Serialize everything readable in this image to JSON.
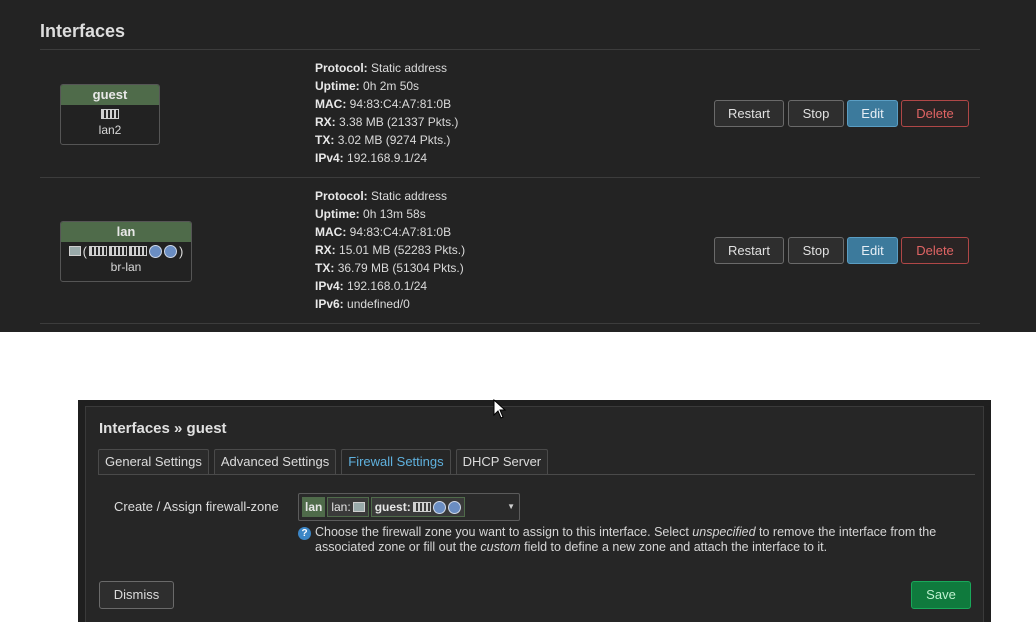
{
  "section_title": "Interfaces",
  "interfaces": [
    {
      "name": "guest",
      "device": "lan2",
      "status": {
        "protocol_label": "Protocol:",
        "protocol": "Static address",
        "uptime_label": "Uptime:",
        "uptime": "0h 2m 50s",
        "mac_label": "MAC:",
        "mac": "94:83:C4:A7:81:0B",
        "rx_label": "RX:",
        "rx": "3.38 MB (21337 Pkts.)",
        "tx_label": "TX:",
        "tx": "3.02 MB (9274 Pkts.)",
        "ipv4_label": "IPv4:",
        "ipv4": "192.168.9.1/24"
      }
    },
    {
      "name": "lan",
      "device": "br-lan",
      "status": {
        "protocol_label": "Protocol:",
        "protocol": "Static address",
        "uptime_label": "Uptime:",
        "uptime": "0h 13m 58s",
        "mac_label": "MAC:",
        "mac": "94:83:C4:A7:81:0B",
        "rx_label": "RX:",
        "rx": "15.01 MB (52283 Pkts.)",
        "tx_label": "TX:",
        "tx": "36.79 MB (51304 Pkts.)",
        "ipv4_label": "IPv4:",
        "ipv4": "192.168.0.1/24",
        "ipv6_label": "IPv6:",
        "ipv6": "undefined/0"
      }
    }
  ],
  "actions": {
    "restart": "Restart",
    "stop": "Stop",
    "edit": "Edit",
    "delete": "Delete"
  },
  "modal": {
    "title": "Interfaces » guest",
    "tabs": [
      "General Settings",
      "Advanced Settings",
      "Firewall Settings",
      "DHCP Server"
    ],
    "active_tab": "Firewall Settings",
    "field_label": "Create / Assign firewall-zone",
    "zone_selected": "lan",
    "zone_lan_label": "lan:",
    "zone_guest_label": "guest:",
    "help_part1": "Choose the firewall zone you want to assign to this interface. Select ",
    "help_em1": "unspecified",
    "help_part2": " to remove the interface from the associated zone or fill out the ",
    "help_em2": "custom",
    "help_part3": " field to define a new zone and attach the interface to it.",
    "dismiss": "Dismiss",
    "save": "Save"
  },
  "colors": {
    "accent": "#5fb1de",
    "zone_green": "#4f6b4a",
    "save_green": "#0f7a3d",
    "delete_red": "#e06464"
  }
}
